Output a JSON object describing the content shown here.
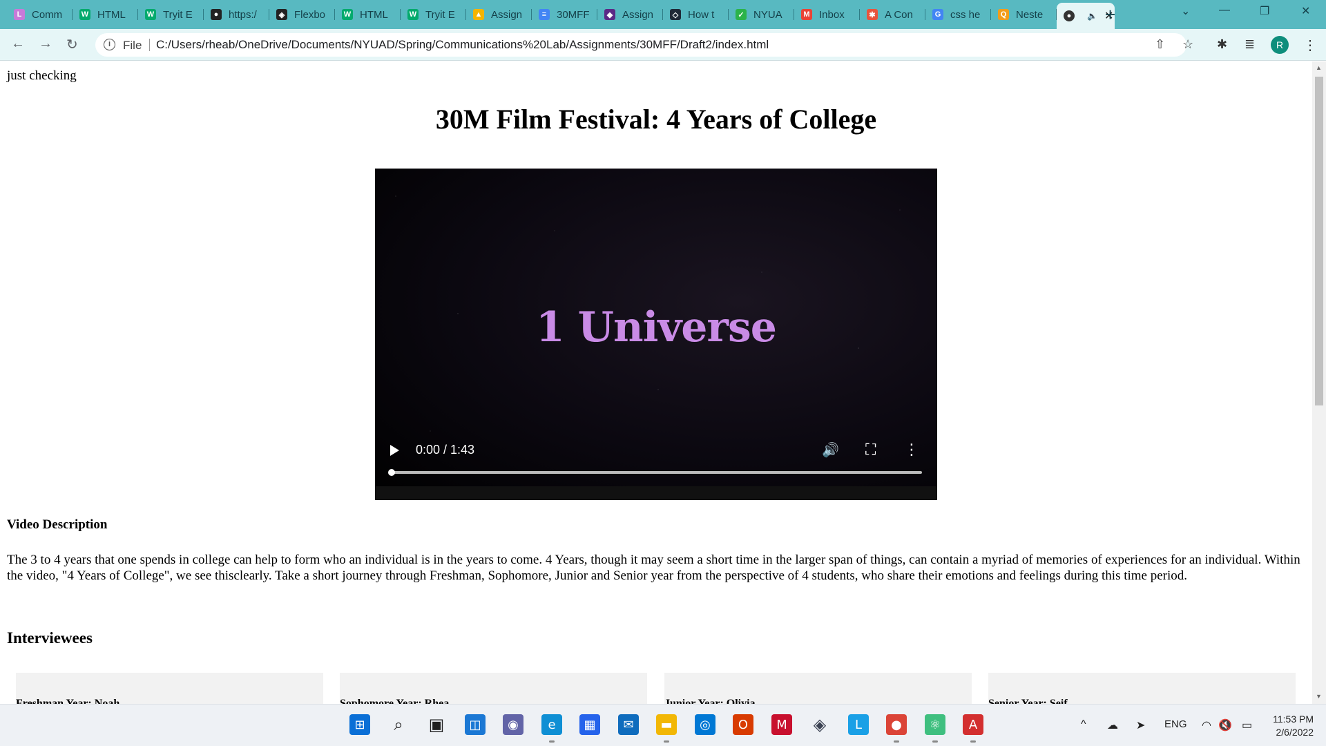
{
  "browser": {
    "tabs": [
      {
        "title": "Comm",
        "favicon": "L",
        "color": "#c77ad9"
      },
      {
        "title": "HTML",
        "favicon": "W",
        "color": "#04aa6d"
      },
      {
        "title": "Tryit E",
        "favicon": "W",
        "color": "#04aa6d"
      },
      {
        "title": "https:/",
        "favicon": "●",
        "color": "#222222"
      },
      {
        "title": "Flexbo",
        "favicon": "◈",
        "color": "#222222"
      },
      {
        "title": "HTML",
        "favicon": "W",
        "color": "#04aa6d"
      },
      {
        "title": "Tryit E",
        "favicon": "W",
        "color": "#04aa6d"
      },
      {
        "title": "Assign",
        "favicon": "▲",
        "color": "#f4b400"
      },
      {
        "title": "30MFF",
        "favicon": "≡",
        "color": "#4285f4"
      },
      {
        "title": "Assign",
        "favicon": "◆",
        "color": "#5b2a86"
      },
      {
        "title": "How t",
        "favicon": "◇",
        "color": "#1f2937"
      },
      {
        "title": "NYUA",
        "favicon": "✓",
        "color": "#2bb34a"
      },
      {
        "title": "Inbox",
        "favicon": "M",
        "color": "#ea4335"
      },
      {
        "title": "A Con",
        "favicon": "✱",
        "color": "#e8553d"
      },
      {
        "title": "css he",
        "favicon": "G",
        "color": "#4285f4"
      },
      {
        "title": "Neste",
        "favicon": "Q",
        "color": "#f29d1a"
      }
    ],
    "active_tab": {
      "favicon": "●",
      "speaker": "🔈",
      "close": "✕"
    },
    "new_tab": "+",
    "window_controls": {
      "dropdown": "⌄",
      "minimize": "—",
      "restore": "❐",
      "close": "✕"
    },
    "nav": {
      "back": "←",
      "forward": "→",
      "reload": "↻"
    },
    "address": {
      "info_icon": "i",
      "scheme_label": "File",
      "url": "C:/Users/rheab/OneDrive/Documents/NYUAD/Spring/Communications%20Lab/Assignments/30MFF/Draft2/index.html"
    },
    "omnibox_icons": {
      "share": "⇧",
      "bookmark": "☆"
    },
    "toolbar_icons": {
      "extensions": "✱",
      "media": "≣"
    },
    "profile_initial": "R",
    "menu": "⋮"
  },
  "page": {
    "top_text": "just checking",
    "title": "30M Film Festival: 4 Years of College",
    "video": {
      "caption": "1 Universe",
      "time": "0:00 / 1:43",
      "progress": 0.0,
      "volume_icon": "🔊",
      "fullscreen_icon": "⛶",
      "more_icon": "⋮"
    },
    "description_heading": "Video Description",
    "description": "The 3 to 4 years that one spends in college can help to form who an individual is in the years to come. 4 Years, though it may seem a short time in the larger span of things, can contain a myriad of memories of experiences for an individual. Within the video, \"4 Years of College\", we see thisclearly. Take a short journey through Freshman, Sophomore, Junior and Senior year from the perspective of 4 students, who share their emotions and feelings during this time period.",
    "interviewees_heading": "Interviewees",
    "interviewees": [
      {
        "label": "Freshman Year: Noah"
      },
      {
        "label": "Sophomore Year: Rhea"
      },
      {
        "label": "Junior Year: Olivia"
      },
      {
        "label": "Senior Year: Seif"
      }
    ]
  },
  "taskbar": {
    "apps": [
      {
        "name": "start-icon",
        "glyph": "⊞",
        "color": "#0a6fd6"
      },
      {
        "name": "search-icon",
        "glyph": "⌕",
        "color": "#1f1f1f"
      },
      {
        "name": "task-view-icon",
        "glyph": "▣",
        "color": "#1f1f1f"
      },
      {
        "name": "widgets-icon",
        "glyph": "◫",
        "color": "#1b78d4"
      },
      {
        "name": "teams-chat-icon",
        "glyph": "◉",
        "color": "#6264a7"
      },
      {
        "name": "edge-icon",
        "glyph": "e",
        "color": "#0f8fd4"
      },
      {
        "name": "store-icon",
        "glyph": "▦",
        "color": "#2563eb"
      },
      {
        "name": "mail-icon",
        "glyph": "✉",
        "color": "#0f6cbd"
      },
      {
        "name": "file-explorer-icon",
        "glyph": "▬",
        "color": "#f2b705"
      },
      {
        "name": "cortana-icon",
        "glyph": "◎",
        "color": "#0078d4"
      },
      {
        "name": "office-icon",
        "glyph": "O",
        "color": "#d83b01"
      },
      {
        "name": "mcafee-icon",
        "glyph": "M",
        "color": "#c8102e"
      },
      {
        "name": "3d-viewer-icon",
        "glyph": "◈",
        "color": "#3b4252"
      },
      {
        "name": "l-app-icon",
        "glyph": "L",
        "color": "#1aa0e6"
      },
      {
        "name": "chrome-icon",
        "glyph": "●",
        "color": "#db4437"
      },
      {
        "name": "atom-icon",
        "glyph": "⚛",
        "color": "#3fbf7f"
      },
      {
        "name": "acrobat-icon",
        "glyph": "A",
        "color": "#d32f2f"
      }
    ],
    "tray": {
      "overflow": "^",
      "onedrive": "☁",
      "location": "➤",
      "language": "ENG",
      "wifi": "◠",
      "volume": "🔇",
      "battery": "▭",
      "time": "11:53 PM",
      "date": "2/6/2022"
    }
  }
}
